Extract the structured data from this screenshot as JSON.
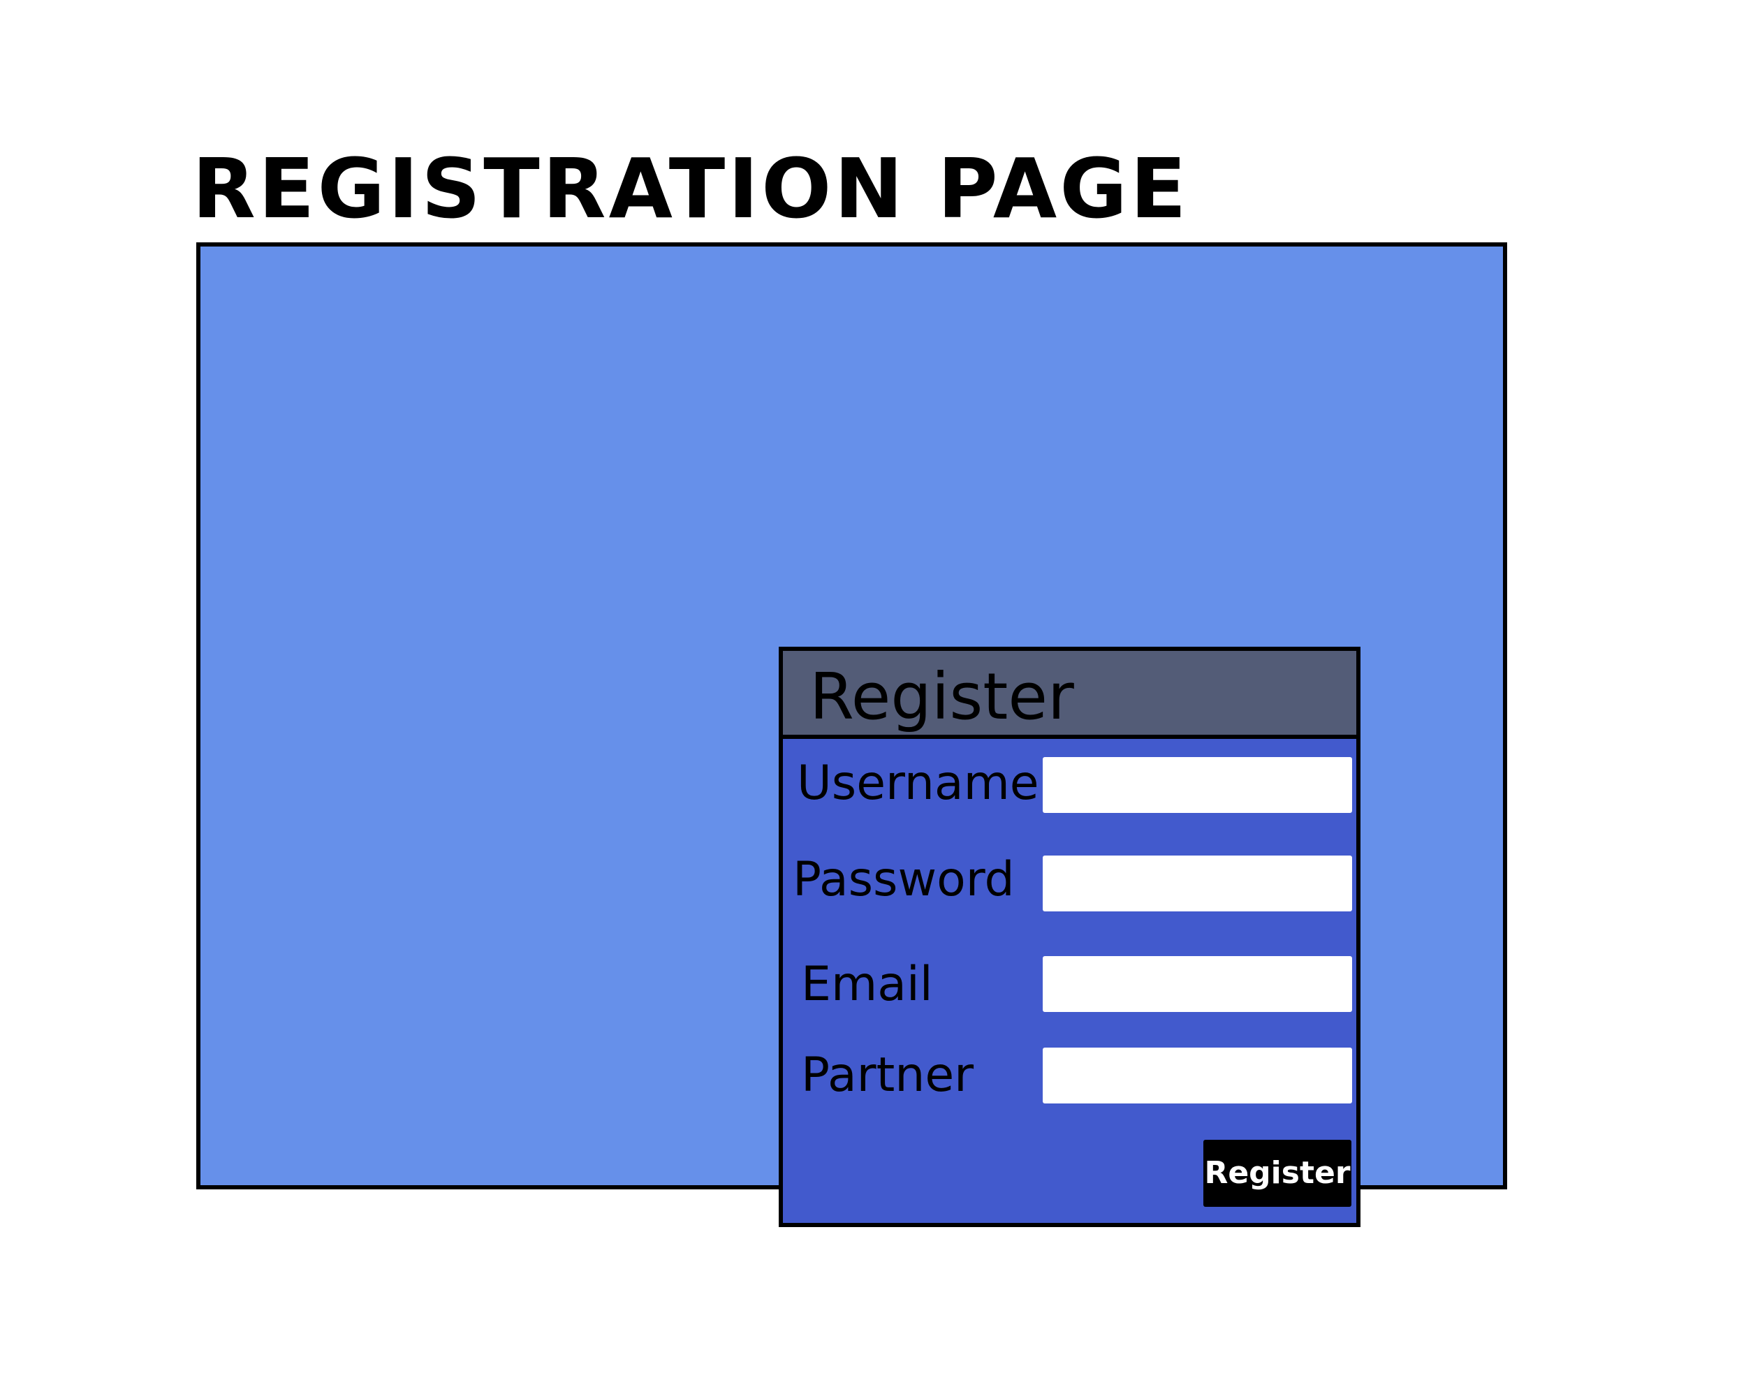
{
  "page": {
    "heading": "REGISTRATION PAGE"
  },
  "window": {
    "background_color": "#6690EA"
  },
  "dialog": {
    "title": "Register",
    "header_color": "#535C77",
    "body_color": "#425ACD",
    "fields": [
      {
        "label": "Username",
        "value": "",
        "placeholder": ""
      },
      {
        "label": "Password",
        "value": "",
        "placeholder": ""
      },
      {
        "label": "Email",
        "value": "",
        "placeholder": ""
      },
      {
        "label": "Partner",
        "value": "",
        "placeholder": ""
      }
    ],
    "submit_label": "Register",
    "submit_color": "#000000"
  }
}
